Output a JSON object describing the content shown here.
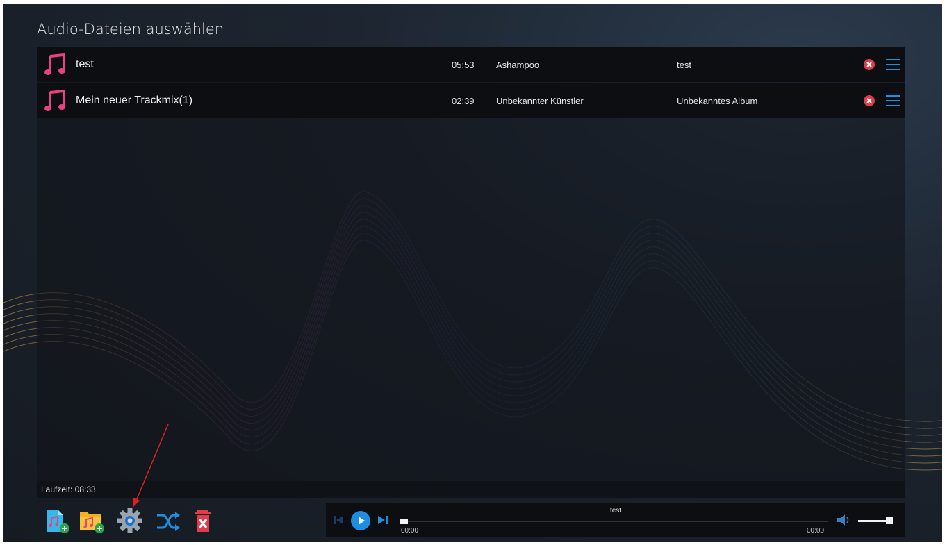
{
  "window": {
    "title": "Audio-Dateien auswählen"
  },
  "tracks": [
    {
      "title": "test",
      "duration": "05:53",
      "artist": "Ashampoo",
      "album": "test",
      "icon": "music-note-icon"
    },
    {
      "title": "Mein neuer Trackmix(1)",
      "duration": "02:39",
      "artist": "Unbekannter Künstler",
      "album": "Unbekanntes Album",
      "icon": "music-note-icon"
    }
  ],
  "status": {
    "runtime": "Laufzeit: 08:33"
  },
  "toolbar": {
    "buttons": [
      {
        "icon": "add-file-icon"
      },
      {
        "icon": "add-folder-icon"
      },
      {
        "icon": "settings-gear-icon"
      },
      {
        "icon": "shuffle-icon"
      },
      {
        "icon": "clear-list-icon"
      }
    ]
  },
  "player": {
    "track_title": "test",
    "time_current": "00:00",
    "time_total": "00:00",
    "progress": 0,
    "volume": 0.85
  },
  "colors": {
    "accent_blue": "#1e8fe0",
    "note_pink": "#e8437a",
    "delete_red": "#e03c4a",
    "row_bg": "#0c0e12"
  }
}
